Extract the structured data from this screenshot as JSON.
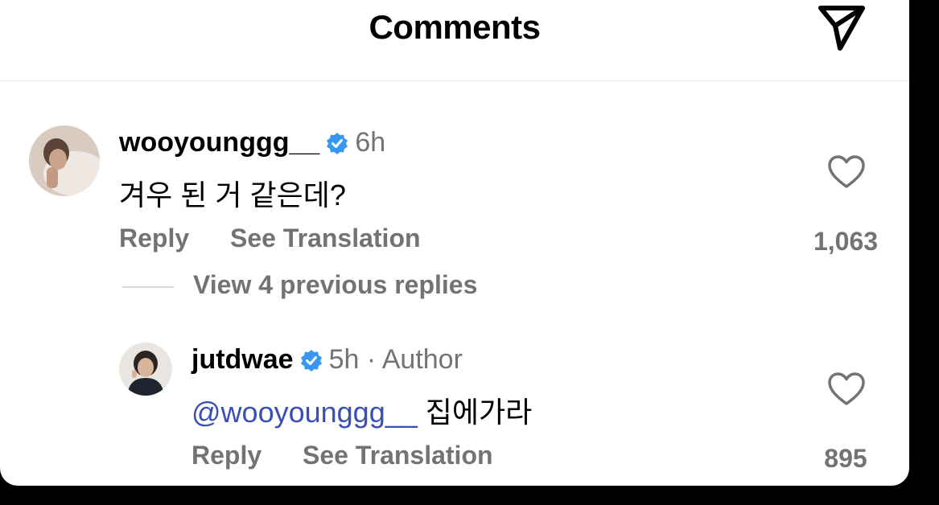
{
  "header": {
    "title": "Comments",
    "share_icon": "paper-plane-icon"
  },
  "comments": [
    {
      "username": "wooyounggg__",
      "verified": true,
      "time": "6h",
      "text": "겨우 된 거 같은데?",
      "reply_label": "Reply",
      "translate_label": "See Translation",
      "likes": "1,063"
    }
  ],
  "view_replies_label": "View 4 previous replies",
  "reply": {
    "username": "jutdwae",
    "verified": true,
    "time": "5h · Author",
    "mention": "@wooyounggg__",
    "text": " 집에가라",
    "reply_label": "Reply",
    "translate_label": "See Translation",
    "likes": "895"
  },
  "colors": {
    "verified_badge": "#3897f0",
    "mention": "#3a4fb5",
    "secondary_text": "#737373"
  }
}
